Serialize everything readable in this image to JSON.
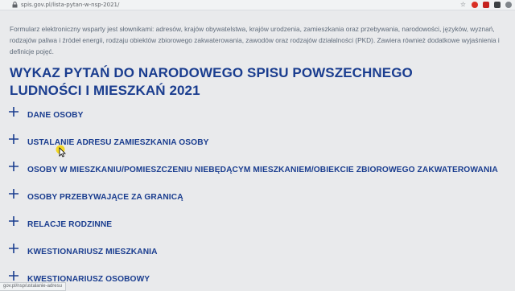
{
  "browser": {
    "url": "spis.gov.pl/lista-pytan-w-nsp-2021/",
    "status_url": "gov.pl/nsp/ustalanie-adresu"
  },
  "page": {
    "intro": "Formularz elektroniczny wsparty jest słownikami: adresów, krajów obywatelstwa, krajów urodzenia, zamieszkania oraz przebywania, narodowości, języków, wyznań, rodzajów paliwa i źródeł energii, rodzaju obiektów zbiorowego zakwaterowania, zawodów oraz rodzajów działalności (PKD). Zawiera również dodatkowe wyjaśnienia i definicje pojęć.",
    "title_line1": "WYKAZ PYTAŃ DO NARODOWEGO SPISU POWSZECHNEGO",
    "title_line2": "LUDNOŚCI I MIESZKAŃ 2021"
  },
  "sections": [
    {
      "label": "DANE OSOBY"
    },
    {
      "label": "USTALANIE ADRESU ZAMIESZKANIA OSOBY"
    },
    {
      "label": "OSOBY W MIESZKANIU/POMIESZCZENIU NIEBĘDĄCYM MIESZKANIEM/OBIEKCIE ZBIOROWEGO ZAKWATEROWANIA"
    },
    {
      "label": "OSOBY PRZEBYWAJĄCE ZA GRANICĄ"
    },
    {
      "label": "RELACJE RODZINNE"
    },
    {
      "label": "KWESTIONARIUSZ MIESZKANIA"
    },
    {
      "label": "KWESTIONARIUSZ OSOBOWY"
    }
  ],
  "colors": {
    "accent": "#1a3d8f",
    "background": "#e9eaec",
    "text_muted": "#5f6b7a",
    "cursor_highlight": "#f5d300"
  },
  "icons": {
    "section_toggle": "plus-icon",
    "address_lock": "lock-icon",
    "bookmark": "star-icon"
  }
}
